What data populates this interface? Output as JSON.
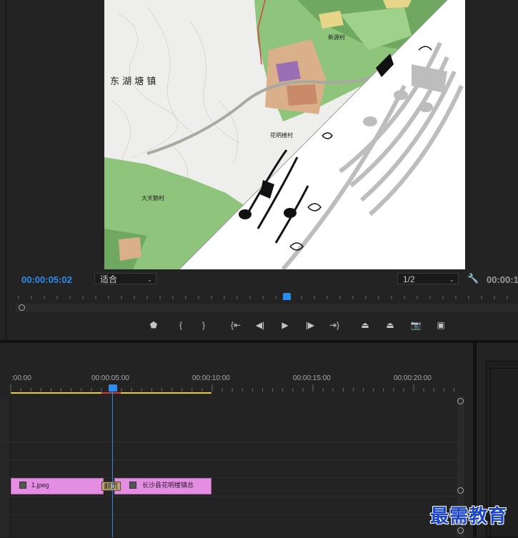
{
  "monitor": {
    "timecode": "00:00:05:02",
    "fit_label": "适合",
    "resolution_label": "1/2",
    "timecode_right": "00:00:1",
    "preview_labels": {
      "town": "东 湖 塘 镇",
      "village_1": "新源村",
      "village_2": "花明楼村",
      "village_3": "大天鹅村"
    },
    "transport_buttons": [
      {
        "name": "add-marker-icon",
        "glyph": "⬟"
      },
      {
        "name": "mark-in-icon",
        "glyph": "{"
      },
      {
        "name": "mark-out-icon",
        "glyph": "}"
      },
      {
        "name": "go-to-in-icon",
        "glyph": "{⇤"
      },
      {
        "name": "step-back-icon",
        "glyph": "◀|"
      },
      {
        "name": "play-icon",
        "glyph": "▶"
      },
      {
        "name": "step-forward-icon",
        "glyph": "|▶"
      },
      {
        "name": "go-to-out-icon",
        "glyph": "⇥}"
      },
      {
        "name": "lift-icon",
        "glyph": "⏏"
      },
      {
        "name": "extract-icon",
        "glyph": "⏏"
      },
      {
        "name": "export-frame-icon",
        "glyph": "📷"
      },
      {
        "name": "comparison-view-icon",
        "glyph": "▣"
      }
    ]
  },
  "timeline": {
    "time_labels": [
      ":00:00",
      "00:00:05:00",
      "00:00:10:00",
      "00:00:15:00",
      "00:00:20:00"
    ],
    "clip_1_label": "1.jpeg",
    "clip_2_label": "长沙县花明楼镇总",
    "transition_label": "翻页"
  },
  "watermark": "最需教育",
  "colors": {
    "accent": "#2d8ceb",
    "clip": "#e38de3",
    "render_bar": "#e8d21a"
  }
}
